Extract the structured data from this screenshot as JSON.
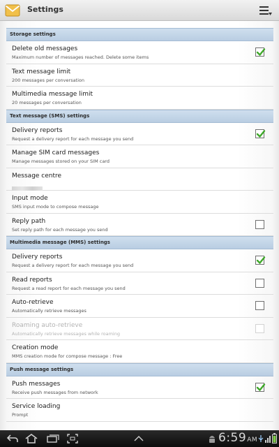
{
  "app": {
    "title": "Settings"
  },
  "sections": [
    {
      "header": "Storage settings",
      "items": [
        {
          "title": "Delete old messages",
          "subtitle": "Maximum number of messages reached. Delete some items",
          "checkbox": true,
          "checked": true
        },
        {
          "title": "Text message limit",
          "subtitle": "200 messages per conversation",
          "checkbox": false
        },
        {
          "title": "Multimedia message limit",
          "subtitle": "20 messages per conversation",
          "checkbox": false
        }
      ]
    },
    {
      "header": "Text message (SMS) settings",
      "items": [
        {
          "title": "Delivery reports",
          "subtitle": "Request a delivery report for each message you send",
          "checkbox": true,
          "checked": true
        },
        {
          "title": "Manage SIM card messages",
          "subtitle": "Manage messages stored on your SIM card",
          "checkbox": false
        },
        {
          "title": "Message centre",
          "subtitle": "",
          "blurred": true,
          "checkbox": false
        },
        {
          "title": "Input mode",
          "subtitle": "SMS input mode to compose message",
          "checkbox": false
        },
        {
          "title": "Reply path",
          "subtitle": "Set reply path for each message you send",
          "checkbox": true,
          "checked": false
        }
      ]
    },
    {
      "header": "Multimedia message (MMS) settings",
      "items": [
        {
          "title": "Delivery reports",
          "subtitle": "Request a delivery report for each message you send",
          "checkbox": true,
          "checked": true
        },
        {
          "title": "Read reports",
          "subtitle": "Request a read report for each message you send",
          "checkbox": true,
          "checked": false
        },
        {
          "title": "Auto-retrieve",
          "subtitle": "Automatically retrieve messages",
          "checkbox": true,
          "checked": false
        },
        {
          "title": "Roaming auto-retrieve",
          "subtitle": "Automatically retrieve messages while roaming",
          "checkbox": true,
          "checked": false,
          "disabled": true
        },
        {
          "title": "Creation mode",
          "subtitle": "MMS creation mode for compose message : Free",
          "checkbox": false
        }
      ]
    },
    {
      "header": "Push message settings",
      "items": [
        {
          "title": "Push messages",
          "subtitle": "Receive push messages from network",
          "checkbox": true,
          "checked": true
        },
        {
          "title": "Service loading",
          "subtitle": "Prompt",
          "checkbox": false
        }
      ]
    }
  ],
  "status_bar": {
    "time": "6:59",
    "ampm": "AM"
  },
  "colors": {
    "section_header": "#c3d6e9",
    "check_green": "#3ea829"
  },
  "icons": {
    "app": "email-envelope-icon",
    "menu": "menu-lines-icon",
    "nav": [
      "back-icon",
      "home-icon",
      "recent-apps-icon",
      "screenshot-icon",
      "up-arrow-icon",
      "android-icon",
      "usb-icon",
      "signal-icon",
      "battery-icon"
    ]
  }
}
